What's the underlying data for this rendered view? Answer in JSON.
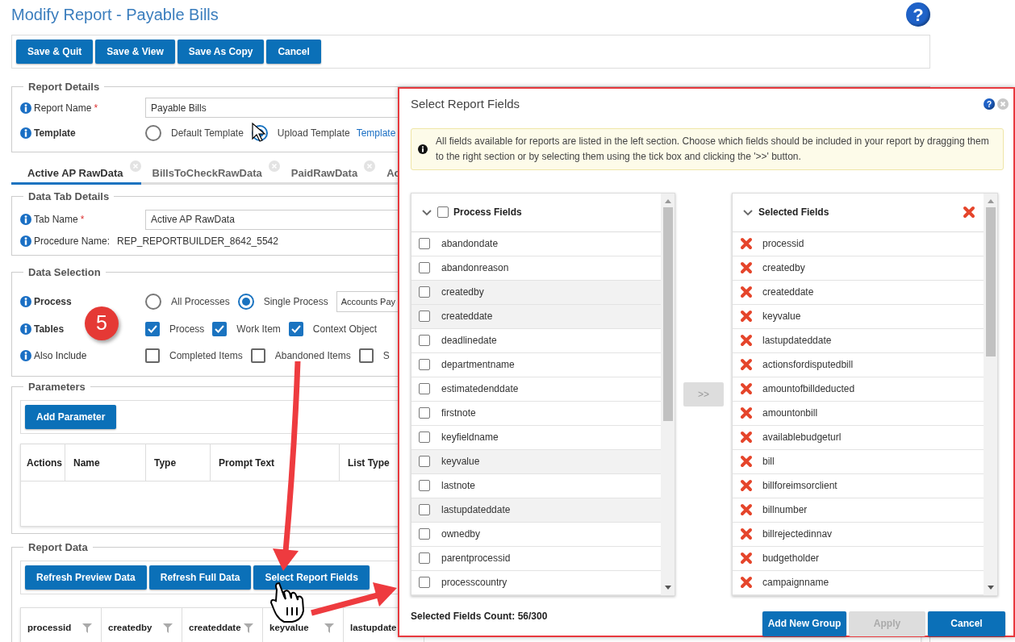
{
  "page": {
    "title": "Modify Report - Payable Bills",
    "help_glyph": "?"
  },
  "toolbar": [
    {
      "label": "Save & Quit"
    },
    {
      "label": "Save & View"
    },
    {
      "label": "Save As Copy"
    },
    {
      "label": "Cancel"
    }
  ],
  "report_details": {
    "legend": "Report Details",
    "name_label": "Report Name",
    "required_mark": "*",
    "name_value": "Payable Bills",
    "template_label": "Template",
    "template_options": [
      {
        "label": "Default Template",
        "selected": false
      },
      {
        "label": "Upload Template",
        "selected": true
      }
    ],
    "template_link": "Template"
  },
  "tabs": [
    {
      "label": "Active AP RawData",
      "selected": true,
      "closable": true
    },
    {
      "label": "BillsToCheckRawData",
      "selected": false,
      "closable": true
    },
    {
      "label": "PaidRawData",
      "selected": false,
      "closable": true
    },
    {
      "label": "Ac",
      "selected": false,
      "closable": false
    }
  ],
  "data_tab_details": {
    "legend": "Data Tab Details",
    "tab_name_label": "Tab Name",
    "required_mark": "*",
    "tab_name_value": "Active AP RawData",
    "procedure_label": "Procedure Name:",
    "procedure_value": "REP_REPORTBUILDER_8642_5542"
  },
  "data_selection": {
    "legend": "Data Selection",
    "process_label": "Process",
    "process_options": [
      {
        "label": "All Processes",
        "selected": false
      },
      {
        "label": "Single Process",
        "selected": true
      }
    ],
    "process_value": "Accounts Pay",
    "tables_label": "Tables",
    "tables": [
      {
        "label": "Process",
        "checked": true
      },
      {
        "label": "Work Item",
        "checked": true
      },
      {
        "label": "Context Object",
        "checked": true
      }
    ],
    "also_include_label": "Also Include",
    "also_include": [
      {
        "label": "Completed Items",
        "checked": false
      },
      {
        "label": "Abandoned Items",
        "checked": false
      },
      {
        "label": "S",
        "checked": false
      }
    ]
  },
  "step_badge": "5",
  "parameters": {
    "legend": "Parameters",
    "add_button": "Add Parameter",
    "columns": [
      "Actions",
      "Name",
      "Type",
      "Prompt Text",
      "List Type"
    ]
  },
  "report_data": {
    "legend": "Report Data",
    "buttons": [
      {
        "label": "Refresh Preview Data"
      },
      {
        "label": "Refresh Full Data"
      },
      {
        "label": "Select Report Fields"
      }
    ],
    "columns": [
      {
        "label": "processid",
        "filter": true
      },
      {
        "label": "createdby",
        "filter": true
      },
      {
        "label": "createddate",
        "filter": true
      },
      {
        "label": "keyvalue",
        "filter": true
      },
      {
        "label": "lastupdate",
        "filter": false
      }
    ]
  },
  "dialog": {
    "title": "Select Report Fields",
    "help_glyph": "?",
    "info": "All fields available for reports are listed in the left section. Choose which fields should be included in your report by dragging them to the right section or by selecting them using the tick box and clicking the '>>' button.",
    "left_list": {
      "title": "Process Fields",
      "checked": false,
      "items": [
        {
          "label": "abandondate",
          "checked": false,
          "highlighted": false
        },
        {
          "label": "abandonreason",
          "checked": false,
          "highlighted": false
        },
        {
          "label": "createdby",
          "checked": false,
          "highlighted": true
        },
        {
          "label": "createddate",
          "checked": false,
          "highlighted": true
        },
        {
          "label": "deadlinedate",
          "checked": false,
          "highlighted": false
        },
        {
          "label": "departmentname",
          "checked": false,
          "highlighted": false
        },
        {
          "label": "estimatedenddate",
          "checked": false,
          "highlighted": false
        },
        {
          "label": "firstnote",
          "checked": false,
          "highlighted": false
        },
        {
          "label": "keyfieldname",
          "checked": false,
          "highlighted": false
        },
        {
          "label": "keyvalue",
          "checked": false,
          "highlighted": true
        },
        {
          "label": "lastnote",
          "checked": false,
          "highlighted": false
        },
        {
          "label": "lastupdateddate",
          "checked": false,
          "highlighted": true
        },
        {
          "label": "ownedby",
          "checked": false,
          "highlighted": false
        },
        {
          "label": "parentprocessid",
          "checked": false,
          "highlighted": false
        },
        {
          "label": "processcountry",
          "checked": false,
          "highlighted": false
        }
      ]
    },
    "move_button": {
      "label": ">>",
      "disabled": true
    },
    "right_list": {
      "title": "Selected Fields",
      "items": [
        "processid",
        "createdby",
        "createddate",
        "keyvalue",
        "lastupdateddate",
        "actionsfordisputedbill",
        "amountofbilldeducted",
        "amountonbill",
        "availablebudgeturl",
        "bill",
        "billforeimsorclient",
        "billnumber",
        "billrejectedinnav",
        "budgetholder",
        "campaignname"
      ]
    },
    "count": "Selected Fields Count: 56/300",
    "buttons": [
      {
        "label": "Add New Group",
        "disabled": false
      },
      {
        "label": "Apply",
        "disabled": true
      },
      {
        "label": "Cancel",
        "disabled": false
      }
    ]
  }
}
